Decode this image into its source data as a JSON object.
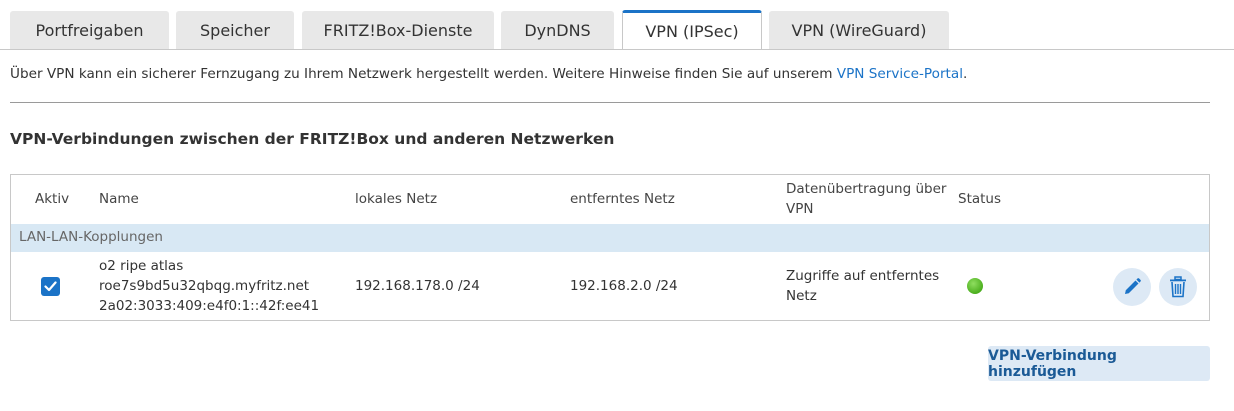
{
  "tabs": [
    {
      "label": "Portfreigaben",
      "active": false
    },
    {
      "label": "Speicher",
      "active": false
    },
    {
      "label": "FRITZ!Box-Dienste",
      "active": false
    },
    {
      "label": "DynDNS",
      "active": false
    },
    {
      "label": "VPN (IPSec)",
      "active": true
    },
    {
      "label": "VPN (WireGuard)",
      "active": false
    }
  ],
  "intro": {
    "text": "Über VPN kann ein sicherer Fernzugang zu Ihrem Netzwerk hergestellt werden. Weitere Hinweise finden Sie auf unserem ",
    "link": "VPN Service-Portal",
    "suffix": "."
  },
  "section_title": "VPN-Verbindungen zwischen der FRITZ!Box und anderen Netzwerken",
  "table": {
    "headers": {
      "active": "Aktiv",
      "name": "Name",
      "local_net": "lokales Netz",
      "remote_net": "entferntes Netz",
      "transfer_line1": "Datenübertragung über",
      "transfer_line2": "VPN",
      "status": "Status"
    },
    "group_label": "LAN-LAN-Kopplungen",
    "rows": [
      {
        "active": true,
        "name_line1": "o2 ripe atlas",
        "name_line2": "roe7s9bd5u32qbqg.myfritz.net",
        "name_line3": "2a02:3033:409:e4f0:1::42f:ee41",
        "local_net": "192.168.178.0 /24",
        "remote_net": "192.168.2.0 /24",
        "transfer_line1": "Zugriffe auf entferntes",
        "transfer_line2": "Netz",
        "status_color": "#4caf1f"
      }
    ]
  },
  "add_button": "VPN-Verbindung hinzufügen",
  "colors": {
    "accent": "#1b73c7",
    "group_row": "#d8e8f4",
    "button_bg": "#dde9f5"
  }
}
